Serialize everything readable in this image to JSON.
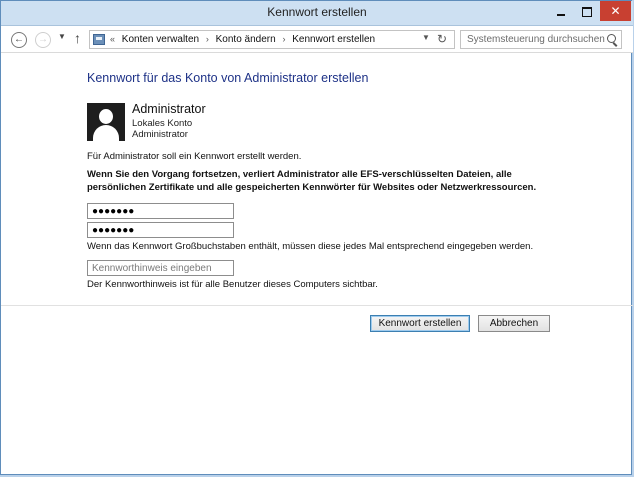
{
  "window": {
    "title": "Kennwort erstellen",
    "controls": {
      "minimize": "minimize-icon",
      "maximize": "maximize-icon",
      "close": "close-icon",
      "close_glyph": "✕"
    }
  },
  "nav": {
    "back": "back-arrow-icon",
    "back_glyph": "←",
    "forward": "forward-arrow-icon",
    "forward_glyph": "→",
    "history": "history-dropdown-icon",
    "history_glyph": "▼",
    "up": "up-arrow-icon",
    "up_glyph": "↑",
    "address": {
      "overflow": "«",
      "crumbs": [
        "Konten verwalten",
        "Konto ändern",
        "Kennwort erstellen"
      ],
      "separator": "›",
      "dropdown_glyph": "▼",
      "refresh_glyph": "↻"
    },
    "search": {
      "placeholder": "Systemsteuerung durchsuchen"
    }
  },
  "main": {
    "heading": "Kennwort für das Konto von Administrator erstellen",
    "user": {
      "name": "Administrator",
      "type": "Lokales Konto",
      "role": "Administrator"
    },
    "info1": "Für Administrator soll ein Kennwort erstellt werden.",
    "warning": "Wenn Sie den Vorgang fortsetzen, verliert Administrator alle EFS-verschlüsselten Dateien, alle persönlichen Zertifikate und alle gespeicherten Kennwörter für Websites oder Netzwerkressourcen.",
    "new_password": {
      "value": "●●●●●●●"
    },
    "confirm_password": {
      "value": "●●●●●●●"
    },
    "case_note": "Wenn das Kennwort Großbuchstaben enthält, müssen diese jedes Mal entsprechend eingegeben werden.",
    "hint": {
      "placeholder": "Kennworthinweis eingeben"
    },
    "hint_note": "Der Kennworthinweis ist für alle Benutzer dieses Computers sichtbar."
  },
  "buttons": {
    "create": "Kennwort erstellen",
    "cancel": "Abbrechen"
  }
}
